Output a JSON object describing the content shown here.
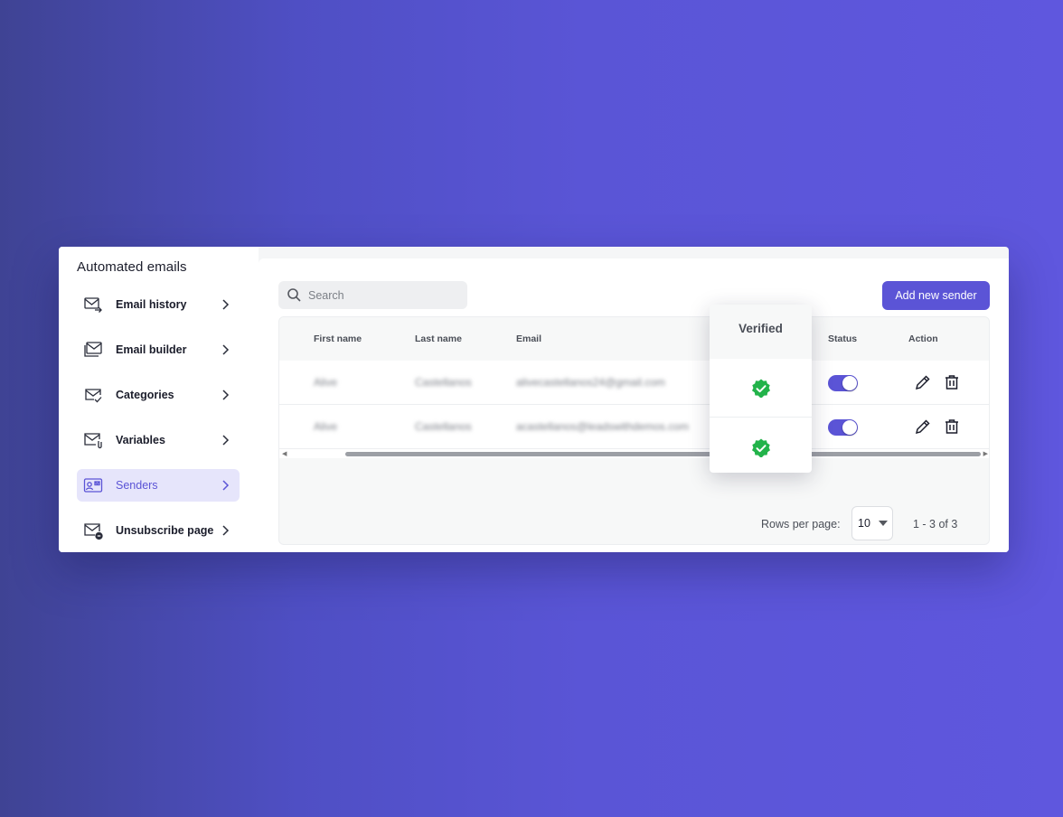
{
  "sidebar": {
    "title": "Automated emails",
    "items": [
      {
        "label": "Email history",
        "icon": "mail-forward-icon",
        "active": false
      },
      {
        "label": "Email builder",
        "icon": "mail-stack-icon",
        "active": false
      },
      {
        "label": "Categories",
        "icon": "mail-check-icon",
        "active": false
      },
      {
        "label": "Variables",
        "icon": "mail-attachment-icon",
        "active": false
      },
      {
        "label": "Senders",
        "icon": "sender-card-icon",
        "active": true
      },
      {
        "label": "Unsubscribe page",
        "icon": "mail-minus-icon",
        "active": false
      }
    ]
  },
  "toolbar": {
    "search_placeholder": "Search",
    "add_button_label": "Add new sender"
  },
  "table": {
    "columns": {
      "first_name": "First name",
      "last_name": "Last name",
      "email": "Email",
      "verified": "Verified",
      "status": "Status",
      "action": "Action"
    },
    "rows": [
      {
        "first_name": "Alive",
        "last_name": "Castellanos",
        "email": "alivecastellanos24@gmail.com",
        "verified": true,
        "status_on": true
      },
      {
        "first_name": "Alive",
        "last_name": "Castellanos",
        "email": "acastellanos@leadswithdemos.com",
        "verified": true,
        "status_on": true
      }
    ]
  },
  "pagination": {
    "rows_per_page_label": "Rows per page:",
    "rows_per_page_value": "10",
    "range_text": "1 - 3 of 3"
  },
  "colors": {
    "accent": "#5b54d6",
    "verified_green": "#22b34a",
    "background_gradient_start": "#3f4394",
    "background_gradient_end": "#5f57de"
  }
}
